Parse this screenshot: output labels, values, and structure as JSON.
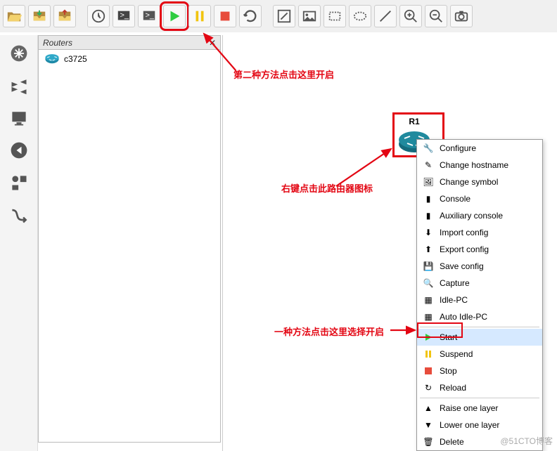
{
  "panel": {
    "title": "Routers",
    "close": "✕"
  },
  "tree": {
    "item": "c3725"
  },
  "router": {
    "label": "R1"
  },
  "menu": {
    "configure": "Configure",
    "change_hostname": "Change hostname",
    "change_symbol": "Change symbol",
    "console": "Console",
    "aux_console": "Auxiliary console",
    "import_config": "Import config",
    "export_config": "Export config",
    "save_config": "Save config",
    "capture": "Capture",
    "idlepc": "Idle-PC",
    "auto_idlepc": "Auto Idle-PC",
    "start": "Start",
    "suspend": "Suspend",
    "stop": "Stop",
    "reload": "Reload",
    "raise": "Raise one layer",
    "lower": "Lower one layer",
    "delete": "Delete"
  },
  "anno": {
    "method2": "第二种方法点击这里开启",
    "rightclick": "右键点击此路由器图标",
    "method1": "一种方法点击这里选择开启"
  },
  "watermark": "@51CTO博客"
}
